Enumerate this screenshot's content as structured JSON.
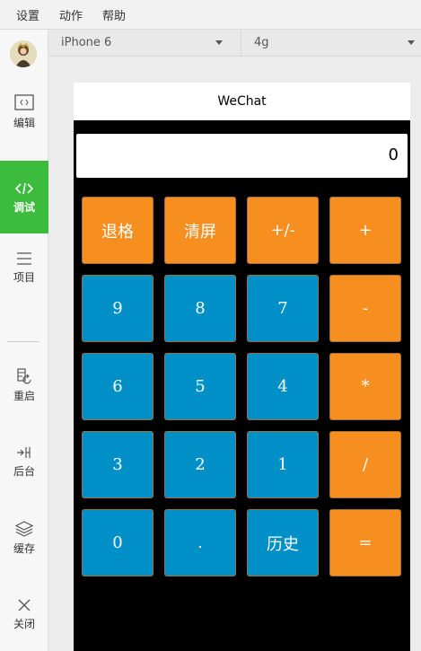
{
  "menu": {
    "items": [
      "设置",
      "动作",
      "帮助"
    ]
  },
  "sidebar": {
    "items": [
      {
        "label": "编辑",
        "icon": "code-editor-icon"
      },
      {
        "label": "调试",
        "icon": "debug-code-icon",
        "active": true
      },
      {
        "label": "项目",
        "icon": "menu-lines-icon"
      },
      {
        "label": "重启",
        "icon": "restart-icon"
      },
      {
        "label": "后台",
        "icon": "background-icon"
      },
      {
        "label": "缓存",
        "icon": "layers-icon"
      },
      {
        "label": "关闭",
        "icon": "close-icon"
      }
    ],
    "active_color": "#3cbc3c"
  },
  "toolbar": {
    "device": "iPhone 6",
    "network": "4g"
  },
  "phone": {
    "title": "WeChat",
    "display_value": "0",
    "colors": {
      "orange": "#f68f20",
      "blue": "#0090c8"
    },
    "keys": [
      [
        "退格",
        "清屏",
        "+/-",
        "+"
      ],
      [
        "9",
        "8",
        "7",
        "-"
      ],
      [
        "6",
        "5",
        "4",
        "*"
      ],
      [
        "3",
        "2",
        "1",
        "/"
      ],
      [
        "0",
        ".",
        "历史",
        "="
      ]
    ]
  }
}
